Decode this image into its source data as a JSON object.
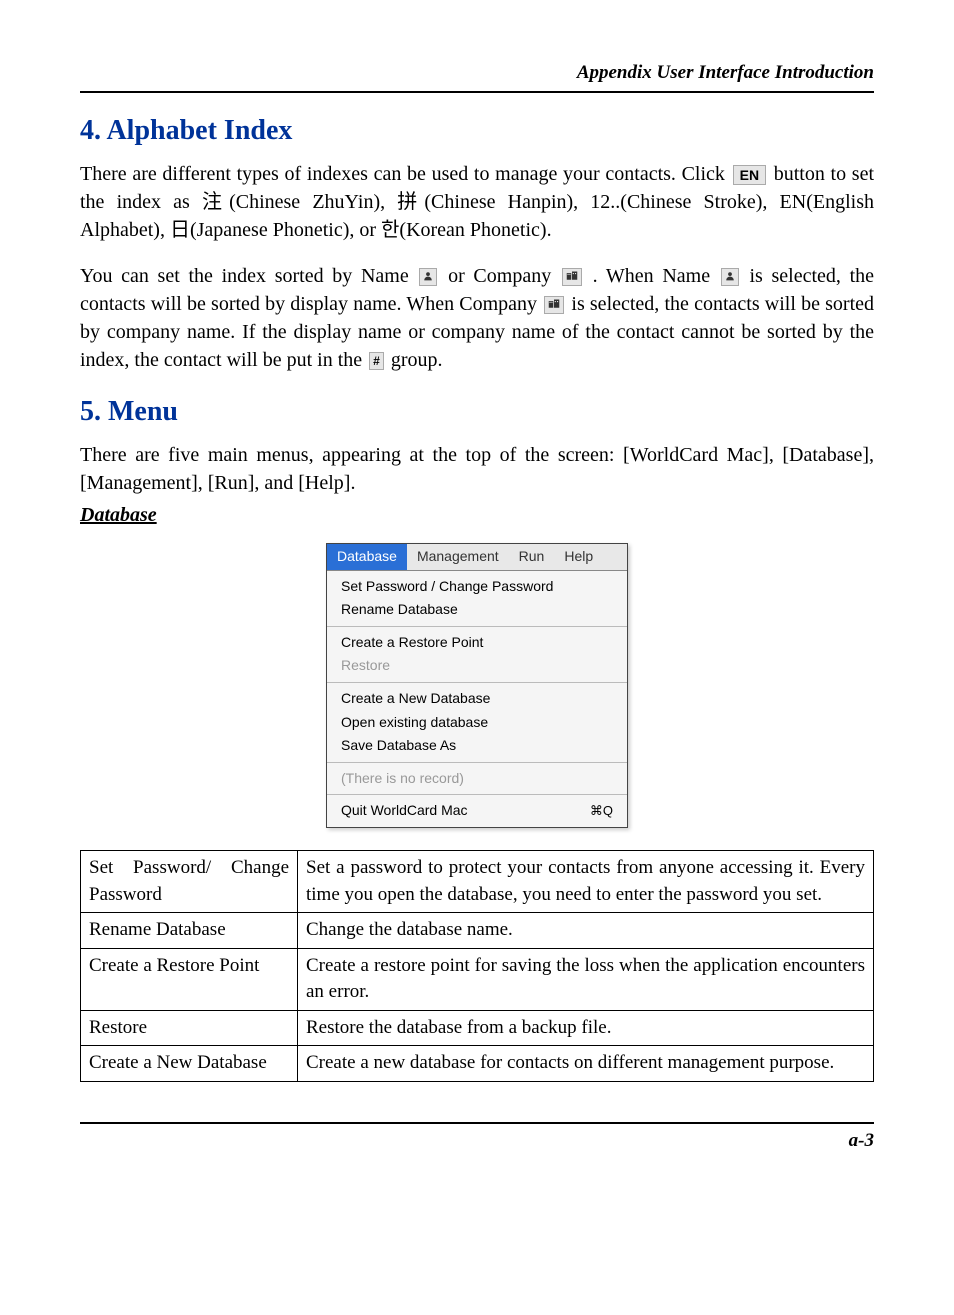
{
  "header": {
    "title": "Appendix User Interface Introduction"
  },
  "section4": {
    "heading": "4. Alphabet Index",
    "para1_pre": "There are different types of indexes can be used to manage your contacts. Click ",
    "en_button": "EN",
    "para1_post": " button to set the index as 注(Chinese ZhuYin), 拼(Chinese Hanpin), 12..(Chinese Stroke), EN(English Alphabet), 日(Japanese Phonetic), or 한(Korean Phonetic).",
    "para2_a": "You can set the index sorted by Name ",
    "para2_b": " or Company ",
    "para2_c": " . When Name ",
    "para2_d": " is selected, the contacts will be sorted by display name. When Company ",
    "para2_e": " is selected, the contacts will be sorted by company name. If the display name or company name of the contact cannot be sorted by the index, the contact will be put in the ",
    "para2_f": " group.",
    "hash_symbol": "#"
  },
  "section5": {
    "heading": "5. Menu",
    "para": "There are five main menus, appearing at the top of the screen: [WorldCard Mac], [Database], [Management], [Run], and [Help].",
    "subheading": "Database"
  },
  "menu": {
    "tabs": {
      "database": "Database",
      "management": "Management",
      "run": "Run",
      "help": "Help"
    },
    "group1": {
      "set_password": "Set Password / Change Password",
      "rename": "Rename Database"
    },
    "group2": {
      "create_restore": "Create a Restore Point",
      "restore": "Restore"
    },
    "group3": {
      "create_new": "Create a New Database",
      "open_existing": "Open existing database",
      "save_as": "Save Database As"
    },
    "group4": {
      "no_record": "(There is no record)"
    },
    "group5": {
      "quit": "Quit WorldCard Mac",
      "quit_shortcut": "⌘Q"
    }
  },
  "defs": {
    "rows": [
      {
        "term": "Set Password/ Change Password",
        "desc": "Set a password to protect your contacts from anyone accessing it. Every time you open the database, you need to enter the password you set."
      },
      {
        "term": "Rename Database",
        "desc": "Change the database name."
      },
      {
        "term": "Create a Restore Point",
        "desc": "Create a restore point for saving the loss when the application encounters an error."
      },
      {
        "term": "Restore",
        "desc": "Restore the database from a backup file."
      },
      {
        "term": "Create a New Database",
        "desc": "Create a new database for contacts on different management purpose."
      }
    ]
  },
  "footer": {
    "page": "a-3"
  }
}
